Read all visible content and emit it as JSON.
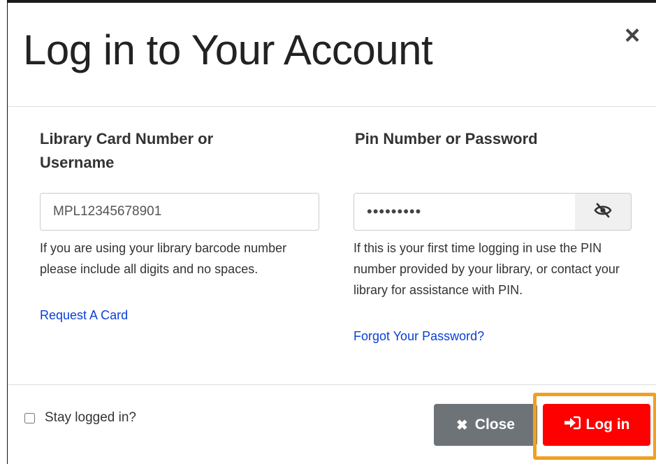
{
  "dialog": {
    "title": "Log in to Your Account",
    "close_icon": "×"
  },
  "username": {
    "label": "Library Card Number or Username",
    "value": "MPL12345678901",
    "help": "If you are using your library barcode number please include all digits and no spaces.",
    "link": "Request A Card"
  },
  "password": {
    "label": "Pin Number or Password",
    "value_masked": "•••••••••",
    "toggle_icon": "eye-slash-icon",
    "help": "If this is your first time logging in use the PIN number provided by your library, or contact your library for assistance with PIN.",
    "link": "Forgot Your Password?"
  },
  "footer": {
    "stay_logged_in_label": "Stay logged in?",
    "stay_logged_in_checked": false,
    "close_label": "Close",
    "close_icon": "✖",
    "login_label": "Log in",
    "login_icon": "sign-in-icon"
  },
  "colors": {
    "login_button": "#ff0000",
    "close_button": "#6e7378",
    "link": "#0a40d6",
    "highlight": "#f0a020"
  }
}
